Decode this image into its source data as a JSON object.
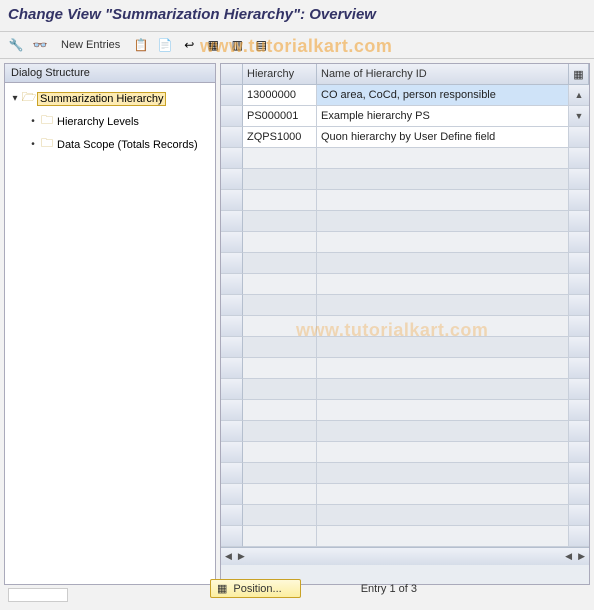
{
  "title": "Change View \"Summarization Hierarchy\": Overview",
  "toolbar": {
    "new_entries": "New Entries"
  },
  "sidebar": {
    "header": "Dialog Structure",
    "root": {
      "label": "Summarization Hierarchy",
      "children": [
        {
          "label": "Hierarchy Levels"
        },
        {
          "label": "Data Scope (Totals Records)"
        }
      ]
    }
  },
  "table": {
    "columns": [
      "Hierarchy",
      "Name of Hierarchy ID"
    ],
    "rows": [
      {
        "hierarchy": "13000000",
        "name": "CO area, CoCd, person responsible",
        "selected": true
      },
      {
        "hierarchy": "PS000001",
        "name": "Example hierarchy PS",
        "selected": false
      },
      {
        "hierarchy": "ZQPS1000",
        "name": "Quon hierarchy by User Define field",
        "selected": false
      }
    ],
    "empty_rows": 19
  },
  "footer": {
    "position_button": "Position...",
    "entry_text": "Entry 1 of 3"
  },
  "watermark": "www.tutorialkart.com"
}
